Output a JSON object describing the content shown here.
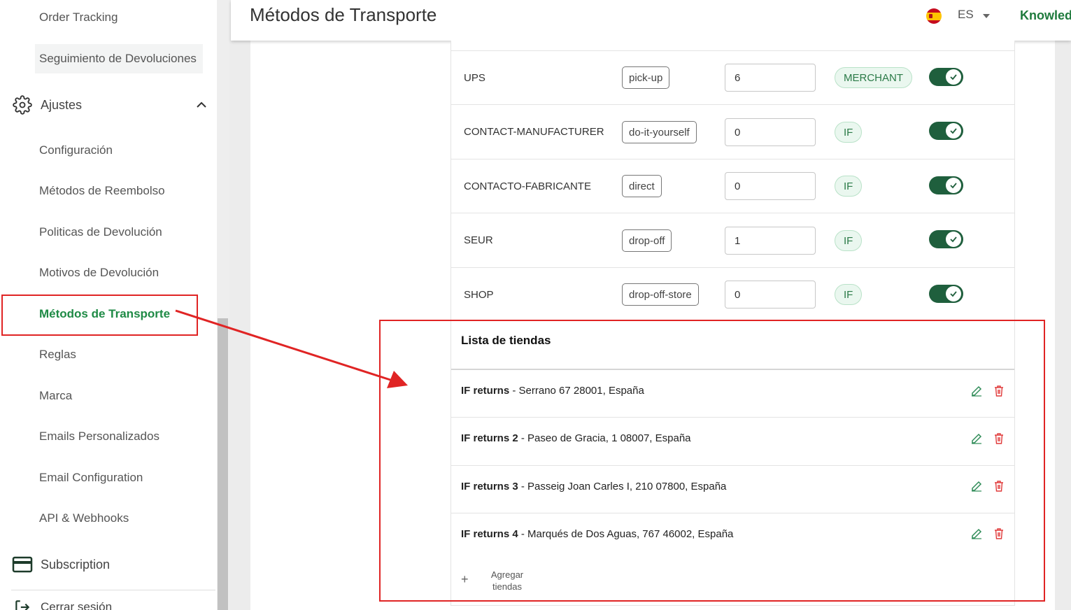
{
  "header": {
    "title": "Métodos de Transporte",
    "language": "ES",
    "brand": "Knowled"
  },
  "sidebar": {
    "items": [
      {
        "label": "Order Tracking"
      },
      {
        "label": "Seguimiento de Devoluciones"
      },
      {
        "label": "Configuración"
      },
      {
        "label": "Métodos de Reembolso"
      },
      {
        "label": "Politicas de Devolución"
      },
      {
        "label": "Motivos de Devolución"
      },
      {
        "label": "Métodos de Transporte",
        "active": true
      },
      {
        "label": "Reglas"
      },
      {
        "label": "Marca"
      },
      {
        "label": "Emails Personalizados"
      },
      {
        "label": "Email Configuration"
      },
      {
        "label": "API & Webhooks"
      }
    ],
    "sections": {
      "settings": "Ajustes",
      "subscription": "Subscription",
      "logout": "Cerrar sesión"
    }
  },
  "methods": [
    {
      "name": "UPS",
      "type": "pick-up",
      "value": "6",
      "badge": "MERCHANT",
      "enabled": true
    },
    {
      "name": "CONTACT-MANUFACTURER",
      "type": "do-it-yourself",
      "value": "0",
      "badge": "IF",
      "enabled": true
    },
    {
      "name": "CONTACTO-FABRICANTE",
      "type": "direct",
      "value": "0",
      "badge": "IF",
      "enabled": true
    },
    {
      "name": "SEUR",
      "type": "drop-off",
      "value": "1",
      "badge": "IF",
      "enabled": true
    },
    {
      "name": "SHOP",
      "type": "drop-off-store",
      "value": "0",
      "badge": "IF",
      "enabled": true
    }
  ],
  "stores": {
    "title": "Lista de tiendas",
    "items": [
      {
        "name": "IF returns",
        "address": " - Serrano 67 28001, España"
      },
      {
        "name": "IF returns 2",
        "address": " - Paseo de Gracia, 1 08007, España"
      },
      {
        "name": "IF returns 3",
        "address": " - Passeig Joan Carles I, 210 07800, España"
      },
      {
        "name": "IF returns 4",
        "address": " - Marqués de Dos Aguas, 767 46002, España"
      }
    ],
    "add_label_1": "Agregar",
    "add_label_2": "tiendas"
  },
  "colors": {
    "accent": "#1e8a45",
    "toggle": "#1f5f3d",
    "annotation": "#e02424"
  }
}
